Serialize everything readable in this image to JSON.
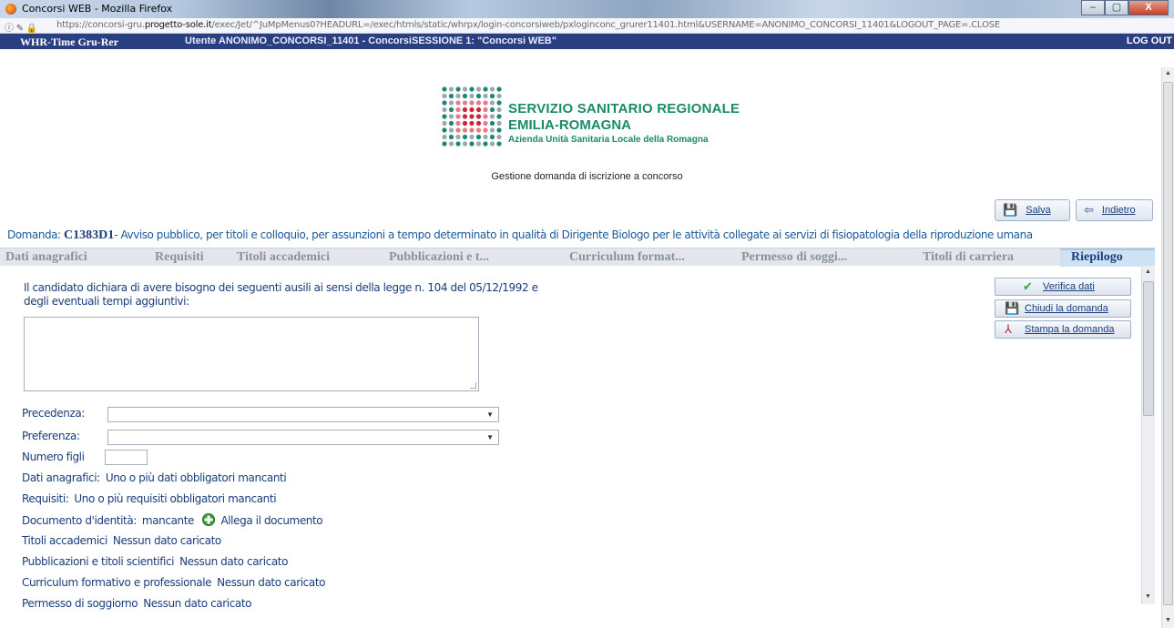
{
  "window": {
    "title": "Concorsi WEB - Mozilla Firefox",
    "minimize": "–",
    "maximize": "▢",
    "close": "X"
  },
  "browser": {
    "url_prefix": "https://concorsi-gru.",
    "url_domain": "progetto-sole.it",
    "url_rest": "/exec/Jet/^JuMpMenus0?HEADURL=/exec/htmls/static/whrpx/login-concorsiweb/pxloginconc_grurer11401.html&USERNAME=ANONIMO_CONCORSI_11401&LOGOUT_PAGE=.CLOSE"
  },
  "appbar": {
    "app_name": "WHR-Time Gru-Rer",
    "user_info": "Utente ANONIMO_CONCORSI_11401 - ConcorsiSESSIONE 1: \"Concorsi WEB\"",
    "logout": "LOG OUT"
  },
  "logo": {
    "line1": "SERVIZIO SANITARIO REGIONALE",
    "line2": "EMILIA-ROMAGNA",
    "line3": "Azienda Unità Sanitaria Locale della Romagna"
  },
  "page_subtitle": "Gestione domanda di iscrizione a concorso",
  "toolbar": {
    "save_label": "Salva",
    "back_label": "Indietro"
  },
  "domanda": {
    "prefix": "Domanda: ",
    "code": "C1383D1",
    "description": "- Avviso pubblico, per titoli e colloquio, per assunzioni a tempo determinato in qualità di Dirigente Biologo per le attività collegate ai servizi di fisiopatologia della riproduzione umana"
  },
  "tabs": [
    {
      "label": "Dati anagrafici"
    },
    {
      "label": "Requisiti"
    },
    {
      "label": "Titoli accademici"
    },
    {
      "label": "Pubblicazioni e t..."
    },
    {
      "label": "Curriculum format..."
    },
    {
      "label": "Permesso di soggi..."
    },
    {
      "label": "Titoli di carriera"
    },
    {
      "label": "Riepilogo"
    }
  ],
  "form": {
    "declaration_line1": "Il candidato dichiara di avere bisogno dei seguenti ausili ai sensi della legge n. 104 del 05/12/1992 e",
    "declaration_line2": "degli eventuali tempi aggiuntivi:",
    "precedenza_label": "Precedenza:",
    "precedenza_value": "",
    "preferenza_label": "Preferenza:",
    "preferenza_value": "",
    "numero_figli_label": "Numero figli",
    "numero_figli_value": ""
  },
  "summary": [
    {
      "label": "Dati anagrafici:",
      "value": "Uno o più dati obbligatori mancanti"
    },
    {
      "label": "Requisiti:",
      "value": "Uno o più requisiti obbligatori mancanti"
    },
    {
      "label": "Documento d'identità:",
      "value": "mancante",
      "action": "Allega il documento"
    },
    {
      "label": "Titoli accademici",
      "value": "Nessun dato caricato"
    },
    {
      "label": "Pubblicazioni e titoli scientifici",
      "value": "Nessun dato caricato"
    },
    {
      "label": "Curriculum formativo e professionale",
      "value": "Nessun dato caricato"
    },
    {
      "label": "Permesso di soggiorno",
      "value": "Nessun dato caricato"
    }
  ],
  "side_actions": {
    "verify": "Verifica dati",
    "close": "Chiudi la domanda",
    "print": "Stampa la domanda"
  },
  "colors": {
    "app_bar": "#2a3f82",
    "text": "#1a3d7a",
    "logo_green": "#1a8a6a",
    "logo_red": "#c8283c",
    "active_tab_bg": "#cfe2f4"
  }
}
